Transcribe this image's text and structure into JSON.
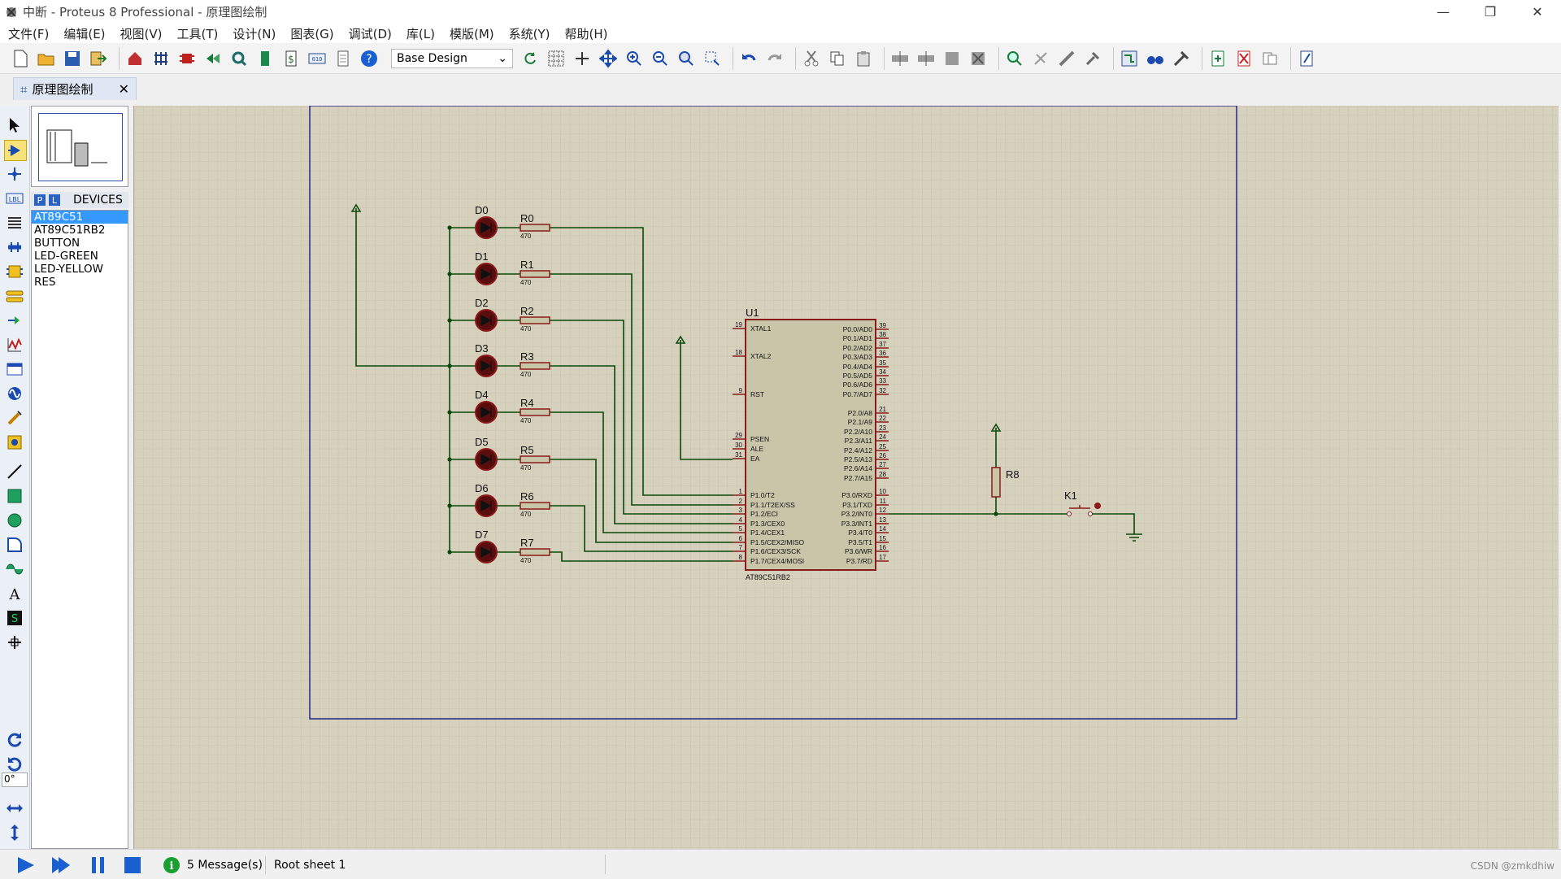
{
  "window": {
    "title": "中断 - Proteus 8 Professional - 原理图绘制",
    "minimize": "—",
    "restore": "❐",
    "close": "✕"
  },
  "menu": [
    "文件(F)",
    "编辑(E)",
    "视图(V)",
    "工具(T)",
    "设计(N)",
    "图表(G)",
    "调试(D)",
    "库(L)",
    "模版(M)",
    "系统(Y)",
    "帮助(H)"
  ],
  "toolbar": {
    "variant_value": "Base Design"
  },
  "tab": {
    "label": "原理图绘制",
    "close": "✕"
  },
  "left_tools": {
    "rotation_value": "0°"
  },
  "devices": {
    "p_label": "P",
    "l_label": "L",
    "header": "DEVICES",
    "items": [
      "AT89C51",
      "AT89C51RB2",
      "BUTTON",
      "LED-GREEN",
      "LED-YELLOW",
      "RES"
    ],
    "selected": "AT89C51"
  },
  "schematic": {
    "leds": [
      "D0",
      "D1",
      "D2",
      "D3",
      "D4",
      "D5",
      "D6",
      "D7"
    ],
    "resistors": [
      "R0",
      "R1",
      "R2",
      "R3",
      "R4",
      "R5",
      "R6",
      "R7"
    ],
    "resistor_value": "470",
    "r8": "R8",
    "button": "K1",
    "mcu": {
      "ref": "U1",
      "part": "AT89C51RB2",
      "left_pins": [
        {
          "num": "19",
          "name": "XTAL1"
        },
        {
          "num": "18",
          "name": "XTAL2"
        },
        {
          "num": "9",
          "name": "RST"
        },
        {
          "num": "29",
          "name": "PSEN"
        },
        {
          "num": "30",
          "name": "ALE"
        },
        {
          "num": "31",
          "name": "EA"
        },
        {
          "num": "1",
          "name": "P1.0/T2"
        },
        {
          "num": "2",
          "name": "P1.1/T2EX/SS"
        },
        {
          "num": "3",
          "name": "P1.2/ECI"
        },
        {
          "num": "4",
          "name": "P1.3/CEX0"
        },
        {
          "num": "5",
          "name": "P1.4/CEX1"
        },
        {
          "num": "6",
          "name": "P1.5/CEX2/MISO"
        },
        {
          "num": "7",
          "name": "P1.6/CEX3/SCK"
        },
        {
          "num": "8",
          "name": "P1.7/CEX4/MOSI"
        }
      ],
      "right_pins": [
        {
          "num": "39",
          "name": "P0.0/AD0"
        },
        {
          "num": "38",
          "name": "P0.1/AD1"
        },
        {
          "num": "37",
          "name": "P0.2/AD2"
        },
        {
          "num": "36",
          "name": "P0.3/AD3"
        },
        {
          "num": "35",
          "name": "P0.4/AD4"
        },
        {
          "num": "34",
          "name": "P0.5/AD5"
        },
        {
          "num": "33",
          "name": "P0.6/AD6"
        },
        {
          "num": "32",
          "name": "P0.7/AD7"
        },
        {
          "num": "21",
          "name": "P2.0/A8"
        },
        {
          "num": "22",
          "name": "P2.1/A9"
        },
        {
          "num": "23",
          "name": "P2.2/A10"
        },
        {
          "num": "24",
          "name": "P2.3/A11"
        },
        {
          "num": "25",
          "name": "P2.4/A12"
        },
        {
          "num": "26",
          "name": "P2.5/A13"
        },
        {
          "num": "27",
          "name": "P2.6/A14"
        },
        {
          "num": "28",
          "name": "P2.7/A15"
        },
        {
          "num": "10",
          "name": "P3.0/RXD"
        },
        {
          "num": "11",
          "name": "P3.1/TXD"
        },
        {
          "num": "12",
          "name": "P3.2/INT0"
        },
        {
          "num": "13",
          "name": "P3.3/INT1"
        },
        {
          "num": "14",
          "name": "P3.4/T0"
        },
        {
          "num": "15",
          "name": "P3.5/T1"
        },
        {
          "num": "16",
          "name": "P3.6/WR"
        },
        {
          "num": "17",
          "name": "P3.7/RD"
        }
      ]
    }
  },
  "status": {
    "messages": "5 Message(s)",
    "sheet": "Root sheet 1",
    "watermark": "CSDN @zmkdhiw"
  },
  "colors": {
    "canvas": "#d6d1bd",
    "wire": "#0b4a0b",
    "component_red": "#8b1a1a",
    "led_fill": "#5a0d0d",
    "chip_fill": "#c9c5a9",
    "border_blue": "#27278a"
  }
}
